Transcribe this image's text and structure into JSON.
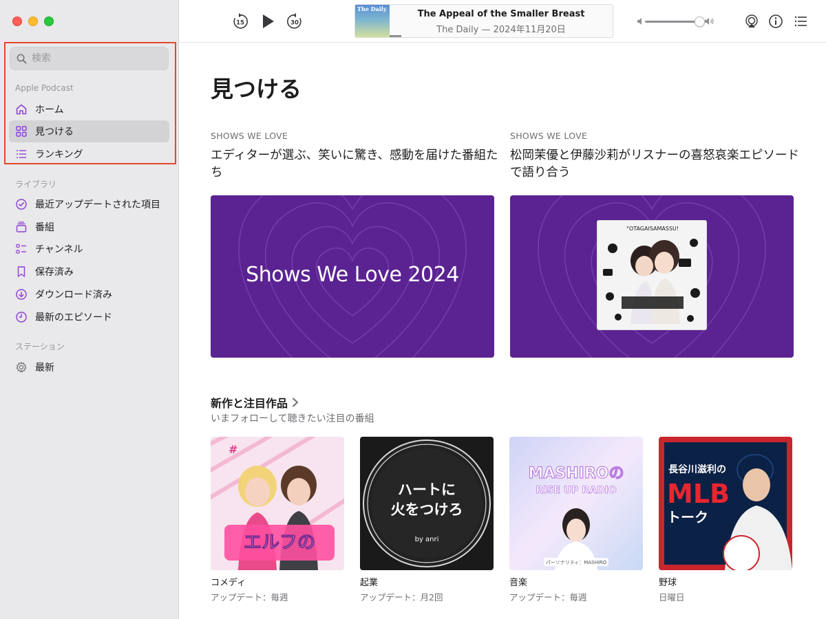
{
  "sidebar": {
    "search_placeholder": "検索",
    "section_apple": "Apple Podcast",
    "apple_items": [
      {
        "label": "ホーム",
        "icon": "home-icon"
      },
      {
        "label": "見つける",
        "icon": "grid-icon",
        "selected": true
      },
      {
        "label": "ランキング",
        "icon": "list-icon"
      }
    ],
    "section_library": "ライブラリ",
    "library_items": [
      {
        "label": "最近アップデートされた項目",
        "icon": "check-circle-icon"
      },
      {
        "label": "番組",
        "icon": "stack-icon"
      },
      {
        "label": "チャンネル",
        "icon": "channel-icon"
      },
      {
        "label": "保存済み",
        "icon": "bookmark-icon"
      },
      {
        "label": "ダウンロード済み",
        "icon": "download-icon"
      },
      {
        "label": "最新のエピソード",
        "icon": "clock-icon"
      }
    ],
    "section_station": "ステーション",
    "station_items": [
      {
        "label": "最新",
        "icon": "gear-icon"
      }
    ]
  },
  "toolbar": {
    "skip_back_label": "15",
    "skip_forward_label": "30",
    "now_playing_title": "The Appeal of the Smaller ⁠Breast",
    "now_playing_subtitle": "The Daily — 2024年11月20日",
    "artwork_text": "The Daily"
  },
  "main": {
    "page_title": "見つける",
    "features": [
      {
        "eyebrow": "SHOWS WE LOVE",
        "title": "エディターが選ぶ、笑いに驚き、感動を届けた番組たち",
        "banner_text": "Shows We Love 2024"
      },
      {
        "eyebrow": "SHOWS WE LOVE",
        "title": "松岡茉優と伊藤沙莉がリスナーの喜怒哀楽エピソードで語り合う",
        "banner_text": ""
      }
    ],
    "section_title": "新作と注目作品",
    "section_subtitle": "いまフォローして聴きたい注目の番組",
    "cards": [
      {
        "genre": "コメディ",
        "meta": "アップデート：毎週",
        "art_text": "エルフの とりま 集合ラジオ!"
      },
      {
        "genre": "起業",
        "meta": "アップデート：月2回",
        "art_text": "ハートに 火をつけろ",
        "art_sub": "by anri"
      },
      {
        "genre": "音楽",
        "meta": "アップデート：毎週",
        "art_text": "MASHIROの RISE UP RADIO",
        "art_sub": "パーソナリティ：MASHIRO"
      },
      {
        "genre": "野球",
        "meta": "日曜日",
        "art_text": "長谷川滋利の MLB トーク"
      }
    ]
  },
  "colors": {
    "accent": "#8b3fd6",
    "banner_purple": "#5b2391",
    "highlight_red": "#e4472c"
  }
}
